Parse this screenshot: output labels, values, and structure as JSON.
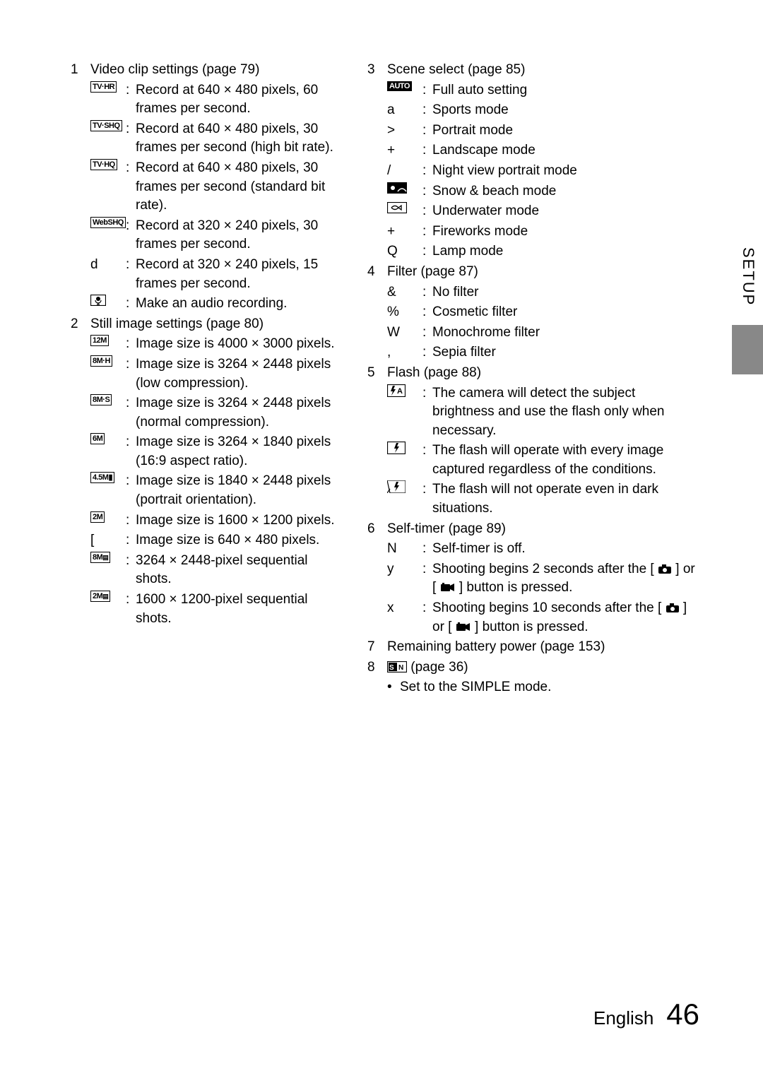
{
  "sideTab": "SETUP",
  "footer": {
    "lang": "English",
    "page": "46"
  },
  "left": [
    {
      "num": "1",
      "title": "Video clip settings (page 79)",
      "items": [
        {
          "symType": "box",
          "sym": "TV·HR",
          "desc": "Record at 640 × 480 pixels, 60 frames per second."
        },
        {
          "symType": "box",
          "sym": "TV·SHQ",
          "desc": "Record at 640 × 480 pixels, 30 frames per second (high bit rate)."
        },
        {
          "symType": "box",
          "sym": "TV·HQ",
          "desc": "Record at 640 × 480 pixels, 30 frames per second (standard bit rate)."
        },
        {
          "symType": "box",
          "sym": "WebSHQ",
          "desc": "Record at 320 × 240 pixels, 30 frames per second."
        },
        {
          "symType": "plain",
          "sym": "d",
          "desc": "Record at 320 × 240 pixels, 15 frames per second."
        },
        {
          "symType": "mic",
          "sym": "",
          "desc": "Make an audio recording."
        }
      ]
    },
    {
      "num": "2",
      "title": "Still image settings (page 80)",
      "items": [
        {
          "symType": "box",
          "sym": "12M",
          "desc": "Image size is 4000 × 3000 pixels."
        },
        {
          "symType": "box",
          "sym": "8M·H",
          "desc": "Image size is 3264 × 2448 pixels (low compression)."
        },
        {
          "symType": "box",
          "sym": "8M·S",
          "desc": "Image size is 3264 × 2448 pixels (normal compression)."
        },
        {
          "symType": "box",
          "sym": "6M",
          "desc": "Image size is 3264 × 1840 pixels (16:9 aspect ratio)."
        },
        {
          "symType": "box",
          "sym": "4.5M▮",
          "desc": "Image size is 1840 × 2448 pixels (portrait orientation)."
        },
        {
          "symType": "box",
          "sym": "2M",
          "desc": "Image size is 1600 × 1200 pixels."
        },
        {
          "symType": "plain",
          "sym": "[",
          "desc": "Image size is 640 × 480 pixels."
        },
        {
          "symType": "seq",
          "sym": "8M",
          "desc": "3264 × 2448-pixel sequential shots."
        },
        {
          "symType": "seq",
          "sym": "2M",
          "desc": "1600 × 1200-pixel sequential shots."
        }
      ]
    }
  ],
  "right": [
    {
      "num": "3",
      "title": "Scene select (page 85)",
      "items": [
        {
          "symType": "dark",
          "sym": "AUTO",
          "desc": "Full auto setting"
        },
        {
          "symType": "plain",
          "sym": "a",
          "desc": "Sports mode"
        },
        {
          "symType": "plain",
          "sym": ">",
          "desc": "Portrait mode"
        },
        {
          "symType": "plain",
          "sym": "+",
          "desc": "Landscape mode"
        },
        {
          "symType": "plain",
          "sym": "/",
          "desc": "Night view portrait mode"
        },
        {
          "symType": "snow",
          "sym": "",
          "desc": "Snow & beach mode"
        },
        {
          "symType": "fish",
          "sym": "",
          "desc": "Underwater mode"
        },
        {
          "symType": "plain",
          "sym": "+",
          "desc": "Fireworks mode"
        },
        {
          "symType": "plain",
          "sym": "Q",
          "desc": "Lamp mode"
        }
      ]
    },
    {
      "num": "4",
      "title": "Filter (page 87)",
      "items": [
        {
          "symType": "plain",
          "sym": "&",
          "desc": "No filter"
        },
        {
          "symType": "plain",
          "sym": "%",
          "desc": "Cosmetic filter"
        },
        {
          "symType": "plain",
          "sym": "W",
          "desc": "Monochrome filter"
        },
        {
          "symType": "plain",
          "sym": ",",
          "desc": "Sepia filter"
        }
      ]
    },
    {
      "num": "5",
      "title": "Flash (page 88)",
      "items": [
        {
          "symType": "flash-a",
          "sym": "",
          "desc": "The camera will detect the subject brightness and use the flash only when necessary."
        },
        {
          "symType": "flash",
          "sym": "",
          "desc": "The flash will operate with every image captured regardless of the conditions."
        },
        {
          "symType": "flash-off",
          "sym": "",
          "desc": "The flash will not operate even in dark situations."
        }
      ]
    },
    {
      "num": "6",
      "title": "Self-timer (page 89)",
      "items": [
        {
          "symType": "plain",
          "sym": "N",
          "desc": "Self-timer is off."
        },
        {
          "symType": "plain",
          "sym": "y",
          "descHtml": "timer2"
        },
        {
          "symType": "plain",
          "sym": "x",
          "descHtml": "timer10"
        }
      ]
    },
    {
      "num": "7",
      "title": "Remaining battery power (page 153)",
      "items": []
    },
    {
      "num": "8",
      "titleHtml": "mode-switch",
      "bullet": "Set to the SIMPLE mode."
    }
  ],
  "specialDesc": {
    "timer2_a": "Shooting begins 2 seconds after the [",
    "timer2_b": "] or [",
    "timer2_c": "] button is pressed.",
    "timer10_a": "Shooting begins 10 seconds after the [",
    "timer10_b": "] or [",
    "timer10_c": "] button is pressed.",
    "mode_page": " (page 36)"
  }
}
